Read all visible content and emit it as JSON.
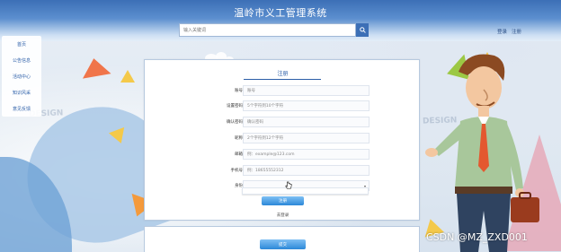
{
  "header": {
    "site_title": "温岭市义工管理系统",
    "search_placeholder": "输入关键词",
    "login_link": "登录",
    "register_link": "注册"
  },
  "left_menu": {
    "items": [
      {
        "label": "首页"
      },
      {
        "label": "公告信息"
      },
      {
        "label": "活动中心"
      },
      {
        "label": "知识风采"
      },
      {
        "label": "意见反馈"
      }
    ]
  },
  "form": {
    "title": "注册",
    "fields": [
      {
        "label": "账号",
        "placeholder": "账号"
      },
      {
        "label": "设置密码",
        "placeholder": "5个字符到10个字符"
      },
      {
        "label": "确认密码",
        "placeholder": "确认密码"
      },
      {
        "label": "昵称",
        "placeholder": "2个字符到12个字符"
      },
      {
        "label": "邮箱",
        "placeholder": "例：example@123.com"
      },
      {
        "label": "手机号",
        "placeholder": "例：18655552312"
      },
      {
        "label": "身份",
        "placeholder": ""
      }
    ],
    "submit_label": "注册",
    "login_link": "去登录"
  },
  "second_card": {
    "button_label": "提交"
  },
  "watermark": "CSDN @MZ_ZXD001",
  "colors": {
    "brand": "#3c6fb6",
    "button": "#2b88d8"
  }
}
